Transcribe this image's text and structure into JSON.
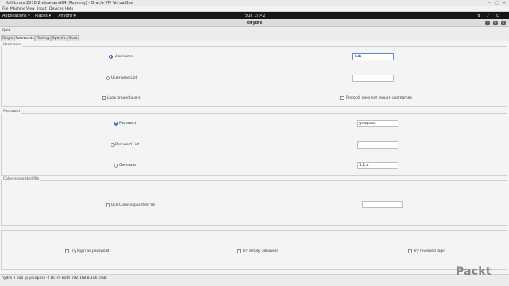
{
  "vbox": {
    "title": "Kali-Linux-2018.2-vbox-amd64 [Running] - Oracle VM VirtualBox",
    "menu": [
      "File",
      "Machine",
      "View",
      "Input",
      "Devices",
      "Help"
    ]
  },
  "topbar": {
    "applications": "Applications ▾",
    "places": "Places ▾",
    "app": "Xhydra ▾",
    "clock": "Sun 19:42"
  },
  "window": {
    "title": "xHydra"
  },
  "quit_label": "Quit",
  "tabs": [
    "Target",
    "Passwords",
    "Tuning",
    "Specific",
    "Start"
  ],
  "username": {
    "section": "Username",
    "username_label": "Username",
    "username_value": "bob",
    "list_label": "Username List",
    "loop_label": "Loop around users",
    "protocol_label": "Protocol does not require usernames"
  },
  "password": {
    "section": "Password",
    "password_label": "Password",
    "password_value": "yourpass",
    "list_label": "Password List",
    "generate_label": "Generate",
    "generate_value": "1:1:a"
  },
  "colon": {
    "section": "Colon separated file",
    "use_label": "Use Colon separated file"
  },
  "options": {
    "try_login": "Try login as password",
    "try_empty": "Try empty password",
    "try_reversed": "Try reversed login"
  },
  "command": "hydra -l bob -p yourpass -t 16 -m Both 192.168.8.106 smb",
  "logo": "Packt"
}
